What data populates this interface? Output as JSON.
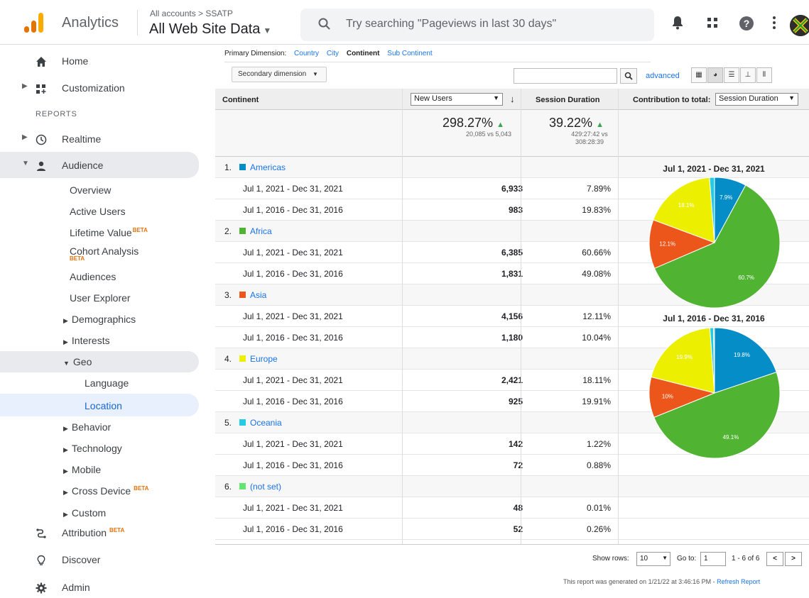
{
  "header": {
    "app_name": "Analytics",
    "breadcrumb": "All accounts > SSATP",
    "account": "All Web Site Data",
    "search_placeholder": "Try searching \"Pageviews in last 30 days\""
  },
  "sidebar": {
    "home": "Home",
    "customization": "Customization",
    "reports_label": "REPORTS",
    "realtime": "Realtime",
    "audience": "Audience",
    "audience_items": [
      "Overview",
      "Active Users",
      "Lifetime Value",
      "Cohort Analysis",
      "Audiences",
      "User Explorer",
      "Demographics",
      "Interests",
      "Geo",
      "Behavior",
      "Technology",
      "Mobile",
      "Cross Device",
      "Custom"
    ],
    "beta": "BETA",
    "geo_items": [
      "Language",
      "Location"
    ],
    "attribution": "Attribution",
    "discover": "Discover",
    "admin": "Admin"
  },
  "dimensions": {
    "label": "Primary Dimension:",
    "options": [
      "Country",
      "City",
      "Continent",
      "Sub Continent"
    ],
    "active": "Continent"
  },
  "toolbar": {
    "secondary": "Secondary dimension",
    "advanced": "advanced"
  },
  "table": {
    "col_continent": "Continent",
    "col_metric": "New Users",
    "col_duration": "Session Duration",
    "col_contribution": "Contribution to total:",
    "contribution_select": "Session Duration",
    "total_new_users_pct": "298.27%",
    "total_new_users_detail": "20,085 vs 5,043",
    "total_duration_pct": "39.22%",
    "total_duration_detail_1": "429:27:42 vs",
    "total_duration_detail_2": "308:28:39",
    "range_2021": "Jul 1, 2021 - Dec 31, 2021",
    "range_2016": "Jul 1, 2016 - Dec 31, 2016",
    "groups": [
      {
        "rank": "1.",
        "name": "Americas",
        "color": "#058dc7",
        "new_2021": "6,933",
        "dur_2021": "7.89%",
        "new_2016": "983",
        "dur_2016": "19.83%"
      },
      {
        "rank": "2.",
        "name": "Africa",
        "color": "#50b432",
        "new_2021": "6,385",
        "dur_2021": "60.66%",
        "new_2016": "1,831",
        "dur_2016": "49.08%"
      },
      {
        "rank": "3.",
        "name": "Asia",
        "color": "#ed561b",
        "new_2021": "4,156",
        "dur_2021": "12.11%",
        "new_2016": "1,180",
        "dur_2016": "10.04%"
      },
      {
        "rank": "4.",
        "name": "Europe",
        "color": "#edef00",
        "new_2021": "2,421",
        "dur_2021": "18.11%",
        "new_2016": "925",
        "dur_2016": "19.91%"
      },
      {
        "rank": "5.",
        "name": "Oceania",
        "color": "#24cbe5",
        "new_2021": "142",
        "dur_2021": "1.22%",
        "new_2016": "72",
        "dur_2016": "0.88%"
      },
      {
        "rank": "6.",
        "name": "(not set)",
        "color": "#64e572",
        "new_2021": "48",
        "dur_2021": "0.01%",
        "new_2016": "52",
        "dur_2016": "0.26%"
      }
    ]
  },
  "chart_data": [
    {
      "type": "pie",
      "title": "Jul 1, 2021 - Dec 31, 2021",
      "categories": [
        "Americas",
        "Africa",
        "Asia",
        "Europe",
        "Oceania",
        "(not set)"
      ],
      "values": [
        7.89,
        60.66,
        12.11,
        18.11,
        1.22,
        0.01
      ],
      "slice_labels": [
        "7.9%",
        "60.7%",
        "12.1%",
        "18.1%",
        "",
        ""
      ],
      "colors": [
        "#058dc7",
        "#50b432",
        "#ed561b",
        "#edef00",
        "#24cbe5",
        "#64e572"
      ]
    },
    {
      "type": "pie",
      "title": "Jul 1, 2016 - Dec 31, 2016",
      "categories": [
        "Americas",
        "Africa",
        "Asia",
        "Europe",
        "Oceania",
        "(not set)"
      ],
      "values": [
        19.83,
        49.08,
        10.04,
        19.91,
        0.88,
        0.26
      ],
      "slice_labels": [
        "19.8%",
        "49.1%",
        "10%",
        "19.9%",
        "",
        ""
      ],
      "colors": [
        "#058dc7",
        "#50b432",
        "#ed561b",
        "#edef00",
        "#24cbe5",
        "#64e572"
      ]
    }
  ],
  "footer": {
    "show_rows": "Show rows:",
    "rows_value": "10",
    "goto": "Go to:",
    "goto_value": "1",
    "range": "1 - 6 of 6",
    "generated": "This report was generated on 1/21/22 at 3:46:16 PM - ",
    "refresh": "Refresh Report"
  }
}
